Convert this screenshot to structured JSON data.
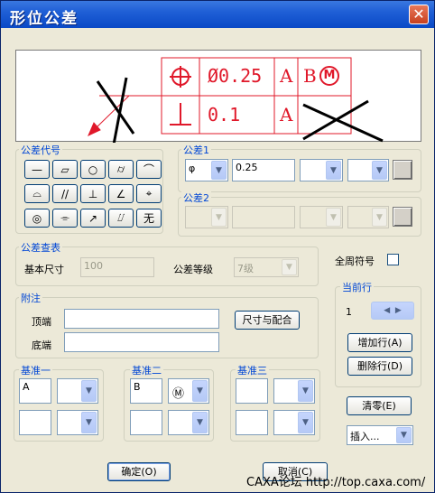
{
  "window": {
    "title": "形位公差",
    "close_label": "✕"
  },
  "preview": {
    "frame": [
      [
        "",
        "Ø0.25",
        "A",
        "B",
        "M"
      ],
      [
        "",
        "0.1",
        "A",
        "",
        ""
      ]
    ]
  },
  "tolerance_codes": {
    "label": "公差代号",
    "buttons": [
      {
        "name": "straightness",
        "glyph": "—"
      },
      {
        "name": "flatness",
        "glyph": "▱"
      },
      {
        "name": "circularity",
        "glyph": "○"
      },
      {
        "name": "cylindricity",
        "glyph": "⌭"
      },
      {
        "name": "line-profile",
        "glyph": "⌒"
      },
      {
        "name": "surface-profile",
        "glyph": "⌓"
      },
      {
        "name": "parallelism",
        "glyph": "//"
      },
      {
        "name": "perpendicularity",
        "glyph": "⊥"
      },
      {
        "name": "angularity",
        "glyph": "∠"
      },
      {
        "name": "position",
        "glyph": "⌖"
      },
      {
        "name": "concentricity",
        "glyph": "◎"
      },
      {
        "name": "symmetry",
        "glyph": "⌯"
      },
      {
        "name": "circular-runout",
        "glyph": "↗"
      },
      {
        "name": "total-runout",
        "glyph": "⌰"
      },
      {
        "name": "none",
        "glyph": "无"
      }
    ]
  },
  "tolerance1": {
    "label": "公差1",
    "prefix": "φ",
    "value": "0.25",
    "symbol": "",
    "modifier": ""
  },
  "tolerance2": {
    "label": "公差2",
    "prefix": "",
    "value": "",
    "symbol": "",
    "modifier": ""
  },
  "lookup": {
    "label": "公差查表",
    "basic_size_label": "基本尺寸",
    "basic_size_value": "100",
    "grade_label": "公差等级",
    "grade_value": "7级"
  },
  "all_around": {
    "label": "全周符号"
  },
  "current_row": {
    "label": "当前行",
    "value": "1",
    "add_label": "增加行(A)",
    "delete_label": "删除行(D)"
  },
  "note": {
    "label": "附注",
    "top_label": "顶端",
    "bottom_label": "底端",
    "fit_label": "尺寸与配合"
  },
  "datums": [
    {
      "label": "基准一",
      "name1": "A",
      "mod1": "",
      "name2": "",
      "mod2": ""
    },
    {
      "label": "基准二",
      "name1": "B",
      "mod1": "Ⓜ",
      "name2": "",
      "mod2": ""
    },
    {
      "label": "基准三",
      "name1": "",
      "mod1": "",
      "name2": "",
      "mod2": ""
    }
  ],
  "actions": {
    "clear_label": "清零(E)",
    "insert_label": "插入...",
    "ok_label": "确定(O)",
    "cancel_label": "取消(C)"
  },
  "watermark": "CAXA论坛 http://top.caxa.com/",
  "colors": {
    "frame_red": "#e0182a",
    "title_blue": "#0a49c6",
    "group_label": "#0046d5"
  }
}
